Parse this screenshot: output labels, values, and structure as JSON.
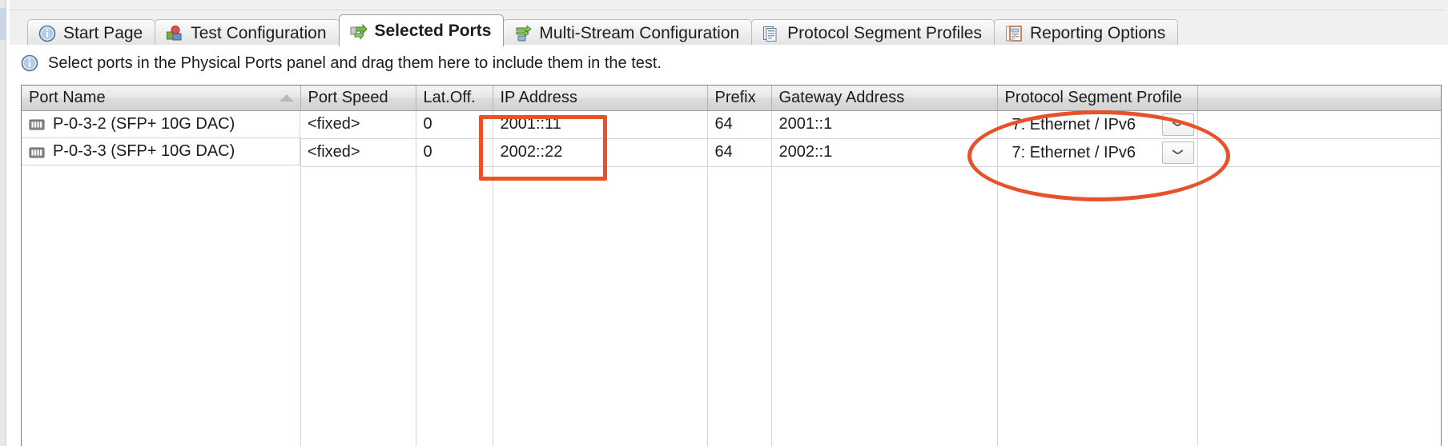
{
  "window": {
    "title": "Selected Ports"
  },
  "tabs": [
    {
      "label": "Start Page",
      "icon": "info-circle-icon",
      "active": false
    },
    {
      "label": "Test Configuration",
      "icon": "cubes-icon",
      "active": false
    },
    {
      "label": "Selected Ports",
      "icon": "green-arrow-ports-icon",
      "active": true
    },
    {
      "label": "Multi-Stream Configuration",
      "icon": "multi-stream-icon",
      "active": false
    },
    {
      "label": "Protocol Segment Profiles",
      "icon": "documents-stack-icon",
      "active": false
    },
    {
      "label": "Reporting Options",
      "icon": "report-notebook-icon",
      "active": false
    }
  ],
  "infobar": {
    "icon": "info-circle-icon",
    "message": "Select ports in the Physical Ports panel and drag them here to include them in the test."
  },
  "grid": {
    "columns": [
      {
        "key": "port_name",
        "label": "Port Name",
        "sorted": true,
        "sort_direction": "ascending"
      },
      {
        "key": "port_speed",
        "label": "Port Speed",
        "sorted": false
      },
      {
        "key": "lat_off",
        "label": "Lat.Off.",
        "sorted": false
      },
      {
        "key": "ip_address",
        "label": "IP Address",
        "sorted": false
      },
      {
        "key": "prefix",
        "label": "Prefix",
        "sorted": false
      },
      {
        "key": "gateway_address",
        "label": "Gateway Address",
        "sorted": false
      },
      {
        "key": "protocol_segment_profile",
        "label": "Protocol Segment Profile",
        "sorted": false
      }
    ],
    "rows": [
      {
        "icon": "port-module-icon",
        "port_name": "P-0-3-2 (SFP+ 10G DAC)",
        "port_speed": "<fixed>",
        "lat_off": "0",
        "ip_address": "2001::11",
        "prefix": "64",
        "gateway_address": "2001::1",
        "protocol_segment_profile": "7: Ethernet / IPv6"
      },
      {
        "icon": "port-module-icon",
        "port_name": "P-0-3-3 (SFP+ 10G DAC)",
        "port_speed": "<fixed>",
        "lat_off": "0",
        "ip_address": "2002::22",
        "prefix": "64",
        "gateway_address": "2002::1",
        "protocol_segment_profile": "7: Ethernet / IPv6"
      }
    ]
  },
  "annotations": [
    {
      "shape": "rectangle",
      "target": "ip-address-column-cells",
      "color": "#e8512a"
    },
    {
      "shape": "ellipse",
      "target": "protocol-segment-profile-column",
      "color": "#e8512a"
    }
  ],
  "colors": {
    "annotation": "#e8512a",
    "tab_active_bg": "#ffffff",
    "header_text": "#1b1b1b"
  }
}
